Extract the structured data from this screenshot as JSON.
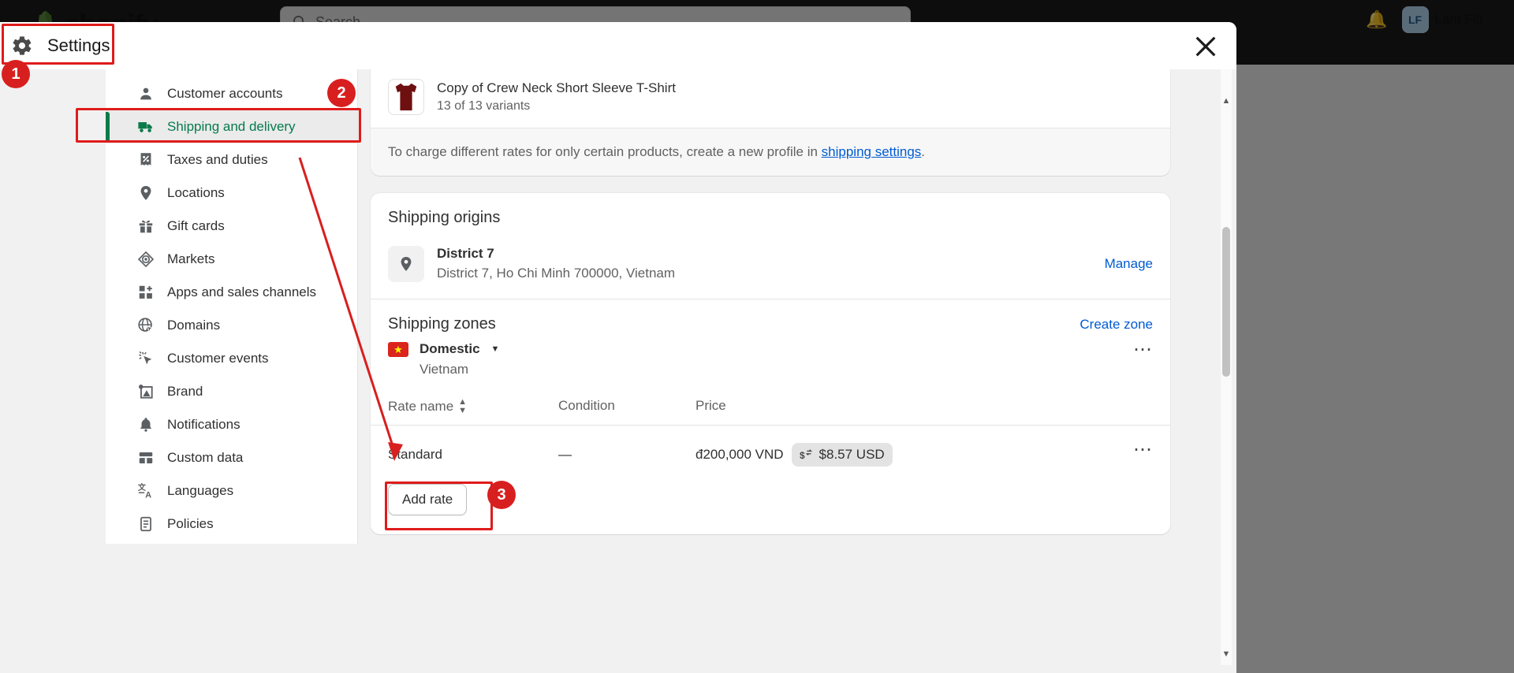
{
  "admin": {
    "brand": "shopify",
    "search_placeholder": "Search",
    "user_name": "Lam Fifi",
    "user_initials": "LF",
    "bell_icon": "bell-icon"
  },
  "modal": {
    "title": "Settings",
    "gear_icon": "gear-icon",
    "close_icon": "close-icon"
  },
  "sidebar": {
    "items": [
      {
        "label": "Customer accounts",
        "icon": "person-icon",
        "active": false
      },
      {
        "label": "Shipping and delivery",
        "icon": "truck-icon",
        "active": true
      },
      {
        "label": "Taxes and duties",
        "icon": "percent-receipt-icon",
        "active": false
      },
      {
        "label": "Locations",
        "icon": "location-pin-icon",
        "active": false
      },
      {
        "label": "Gift cards",
        "icon": "gift-icon",
        "active": false
      },
      {
        "label": "Markets",
        "icon": "markets-globe-icon",
        "active": false
      },
      {
        "label": "Apps and sales channels",
        "icon": "apps-grid-plus-icon",
        "active": false
      },
      {
        "label": "Domains",
        "icon": "globe-cursor-icon",
        "active": false
      },
      {
        "label": "Customer events",
        "icon": "click-sparkle-icon",
        "active": false
      },
      {
        "label": "Brand",
        "icon": "brand-image-icon",
        "active": false
      },
      {
        "label": "Notifications",
        "icon": "bell-icon",
        "active": false
      },
      {
        "label": "Custom data",
        "icon": "database-icon",
        "active": false
      },
      {
        "label": "Languages",
        "icon": "translate-icon",
        "active": false
      },
      {
        "label": "Policies",
        "icon": "scroll-icon",
        "active": false
      }
    ]
  },
  "content": {
    "product": {
      "name": "Copy of Crew Neck Short Sleeve T-Shirt",
      "variants": "13 of 13 variants",
      "thumb_icon": "tshirt-thumbnail"
    },
    "notice": {
      "text_before": "To charge different rates for only certain products, create a new profile in ",
      "link_text": "shipping settings",
      "text_after": "."
    },
    "shipping_origins": {
      "title": "Shipping origins",
      "pin_icon": "location-pin-icon",
      "location_name": "District 7",
      "location_address": "District 7, Ho Chi Minh 700000, Vietnam",
      "manage_link": "Manage"
    },
    "shipping_zones": {
      "title": "Shipping zones",
      "create_link": "Create zone",
      "zone": {
        "flag_icon": "vietnam-flag-icon",
        "name": "Domestic",
        "caret_icon": "chevron-down-icon",
        "country": "Vietnam",
        "overflow_icon": "ellipsis-icon"
      },
      "table": {
        "headers": [
          "Rate name",
          "Condition",
          "Price"
        ],
        "sort_icon": "sort-arrows-icon",
        "rows": [
          {
            "rate_name": "Standard",
            "condition": "—",
            "price_local": "đ200,000 VND",
            "price_usd": "$8.57 USD",
            "currency_icon": "currency-convert-icon",
            "overflow_icon": "ellipsis-icon"
          }
        ]
      },
      "add_rate_button": "Add rate"
    }
  },
  "annotations": {
    "badges": [
      {
        "number": "1"
      },
      {
        "number": "2"
      },
      {
        "number": "3"
      }
    ],
    "accent_color": "#d81f1f"
  }
}
